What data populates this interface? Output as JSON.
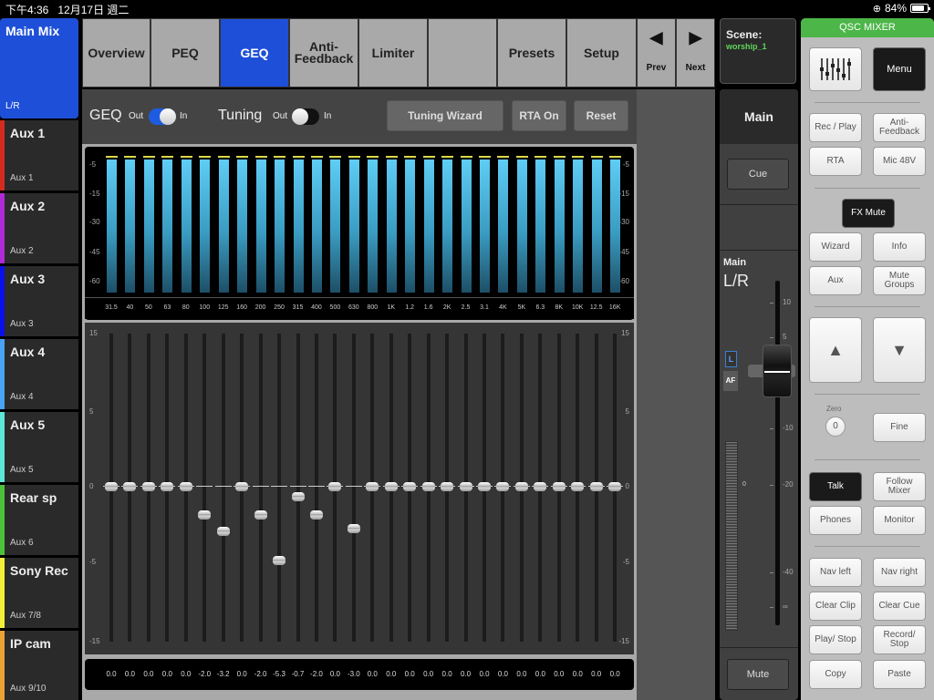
{
  "status_bar": {
    "time": "下午4:36",
    "date": "12月17日 週二",
    "battery": "84%",
    "battery_level": 0.84
  },
  "channels": [
    {
      "name": "Main Mix",
      "sub": "L/R",
      "color": "#1e4fd8",
      "selected": true
    },
    {
      "name": "Aux 1",
      "sub": "Aux 1",
      "color": "#d42b1e"
    },
    {
      "name": "Aux 2",
      "sub": "Aux 2",
      "color": "#b02bd6"
    },
    {
      "name": "Aux 3",
      "sub": "Aux 3",
      "color": "#0a10e8"
    },
    {
      "name": "Aux 4",
      "sub": "Aux 4",
      "color": "#4aa3f5"
    },
    {
      "name": "Aux 5",
      "sub": "Aux 5",
      "color": "#5ce8d6"
    },
    {
      "name": "Rear sp",
      "sub": "Aux 6",
      "color": "#4cc23a"
    },
    {
      "name": "Sony Rec",
      "sub": "Aux 7/8",
      "color": "#f2ee3a"
    },
    {
      "name": "IP cam",
      "sub": "Aux 9/10",
      "color": "#eaa234"
    }
  ],
  "tabs": [
    {
      "label": "Overview"
    },
    {
      "label": "PEQ"
    },
    {
      "label": "GEQ",
      "active": true
    },
    {
      "label": "Anti-\nFeedback"
    },
    {
      "label": "Limiter"
    },
    {
      "label": ""
    },
    {
      "label": "Presets"
    },
    {
      "label": "Setup"
    }
  ],
  "nav": {
    "prev": "Prev",
    "next": "Next"
  },
  "scene": {
    "label": "Scene:",
    "name": "worship_1"
  },
  "geq": {
    "title": "GEQ",
    "geq_toggle": {
      "off_label": "Out",
      "on_label": "In",
      "on": true
    },
    "tuning_title": "Tuning",
    "tuning_toggle": {
      "off_label": "Out",
      "on_label": "In",
      "on": false
    },
    "buttons": {
      "tuning_wizard": "Tuning Wizard",
      "rta_on": "RTA On",
      "reset": "Reset"
    },
    "rta_scale": [
      "-5",
      "-15",
      "-30",
      "-45",
      "-60"
    ],
    "gain_scale": [
      "15",
      "5",
      "0",
      "-5",
      "-15"
    ],
    "bands": [
      "31.5",
      "40",
      "50",
      "63",
      "80",
      "100",
      "125",
      "160",
      "200",
      "250",
      "315",
      "400",
      "500",
      "630",
      "800",
      "1K",
      "1.2",
      "1.6",
      "2K",
      "2.5",
      "3.1",
      "4K",
      "5K",
      "6.3",
      "8K",
      "10K",
      "12.5",
      "16K"
    ],
    "gains": [
      0.0,
      0.0,
      0.0,
      0.0,
      0.0,
      -2.0,
      -3.2,
      0.0,
      -2.0,
      -5.3,
      -0.7,
      -2.0,
      0.0,
      -3.0,
      0.0,
      0.0,
      0.0,
      0.0,
      0.0,
      0.0,
      0.0,
      0.0,
      0.0,
      0.0,
      0.0,
      0.0,
      0.0,
      0.0
    ],
    "gain_labels": [
      "0.0",
      "0.0",
      "0.0",
      "0.0",
      "0.0",
      "-2.0",
      "-3.2",
      "0.0",
      "-2.0",
      "-5.3",
      "-0.7",
      "-2.0",
      "0.0",
      "-3.0",
      "0.0",
      "0.0",
      "0.0",
      "0.0",
      "0.0",
      "0.0",
      "0.0",
      "0.0",
      "0.0",
      "0.0",
      "0.0",
      "0.0",
      "0.0",
      "0.0"
    ]
  },
  "main_strip": {
    "header": "Main",
    "cue": "Cue",
    "label_top": "Main",
    "label_main": "L/R",
    "l_badge": "L",
    "af_badge": "AF",
    "meter_zero": "0",
    "fader_scale": [
      "10",
      "5",
      "-10",
      "-20",
      "-40",
      "∞"
    ],
    "mute": "Mute"
  },
  "qsc": {
    "title": "QSC MIXER",
    "menu": "Menu",
    "rec_play": "Rec / Play",
    "anti_feedback": "Anti-\nFeedback",
    "rta": "RTA",
    "mic48v": "Mic 48V",
    "fx_mute": "FX Mute",
    "wizard": "Wizard",
    "info": "Info",
    "aux": "Aux",
    "mute_groups": "Mute\nGroups",
    "zero_label": "Zero",
    "zero_btn": "0",
    "fine": "Fine",
    "talk": "Talk",
    "follow_mixer": "Follow\nMixer",
    "phones": "Phones",
    "monitor": "Monitor",
    "nav_left": "Nav left",
    "nav_right": "Nav right",
    "clear_clip": "Clear Clip",
    "clear_cue": "Clear Cue",
    "play_stop": "Play/ Stop",
    "record_stop": "Record/\nStop",
    "copy": "Copy",
    "paste": "Paste"
  }
}
